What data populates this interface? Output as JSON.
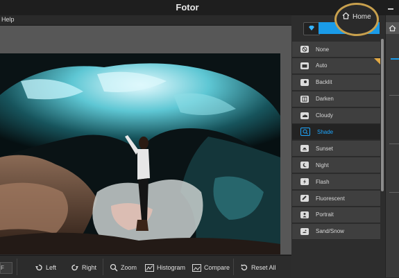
{
  "window": {
    "title": "Fotor"
  },
  "menu": {
    "help": "Help"
  },
  "home": {
    "label": "Home"
  },
  "presets": [
    {
      "label": "None",
      "icon": "none-icon",
      "selected": false
    },
    {
      "label": "Auto",
      "icon": "camera-auto-icon",
      "selected": false,
      "badge": true
    },
    {
      "label": "Backlit",
      "icon": "backlit-icon",
      "selected": false
    },
    {
      "label": "Darken",
      "icon": "darken-icon",
      "selected": false
    },
    {
      "label": "Cloudy",
      "icon": "cloudy-icon",
      "selected": false
    },
    {
      "label": "Shade",
      "icon": "shade-icon",
      "selected": true
    },
    {
      "label": "Sunset",
      "icon": "sunset-icon",
      "selected": false
    },
    {
      "label": "Night",
      "icon": "night-icon",
      "selected": false
    },
    {
      "label": "Flash",
      "icon": "flash-icon",
      "selected": false
    },
    {
      "label": "Fluorescent",
      "icon": "fluorescent-icon",
      "selected": false
    },
    {
      "label": "Portrait",
      "icon": "portrait-icon",
      "selected": false
    },
    {
      "label": "Sand/Snow",
      "icon": "sand-snow-icon",
      "selected": false
    }
  ],
  "toolbar": {
    "zoom_value": "F",
    "left": "Left",
    "right": "Right",
    "zoom": "Zoom",
    "histogram": "Histogram",
    "compare": "Compare",
    "reset_all": "Reset All"
  },
  "colors": {
    "accent": "#1a9be8",
    "selected_text": "#1ea7ff",
    "callout": "#c8a04d"
  }
}
